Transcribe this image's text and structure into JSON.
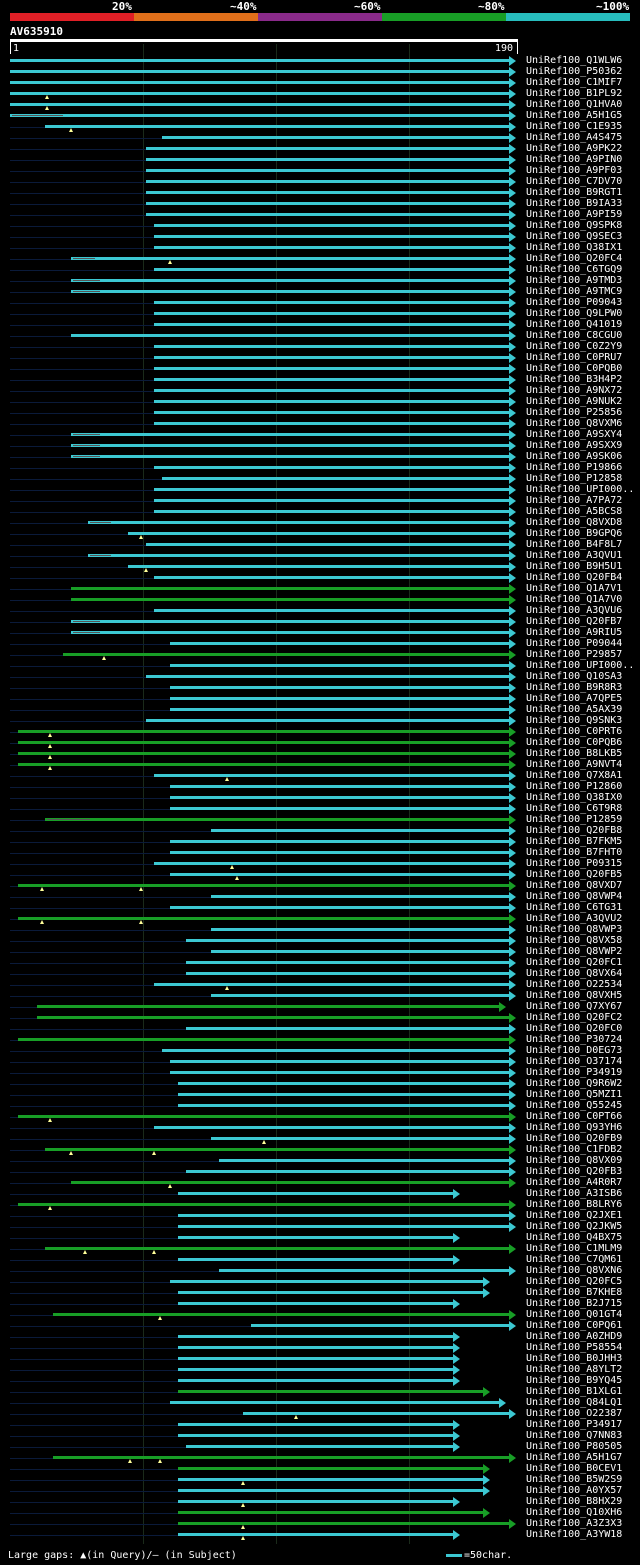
{
  "legend": {
    "labels": [
      "20%",
      "~40%",
      "~60%",
      "~80%",
      "~100%"
    ],
    "colors": [
      "#e01f26",
      "#e06f1a",
      "#8a2a8a",
      "#189e26",
      "#27bcbd"
    ]
  },
  "query": {
    "name": "AV635910",
    "start": "1",
    "end": "190"
  },
  "hits": [
    {
      "id": "UniRef100_Q1WLW6",
      "s": 1,
      "e": 190,
      "c": "#3cc8d2"
    },
    {
      "id": "UniRef100_P50362",
      "s": 1,
      "e": 190,
      "c": "#3cc8d2"
    },
    {
      "id": "UniRef100_C1MIF7",
      "s": 1,
      "e": 190,
      "c": "#3cc8d2"
    },
    {
      "id": "UniRef100_B1PL92",
      "s": 1,
      "e": 190,
      "c": "#3cc8d2",
      "m": [
        15
      ]
    },
    {
      "id": "UniRef100_Q1HVA0",
      "s": 1,
      "e": 190,
      "c": "#3cc8d2",
      "m": [
        15
      ]
    },
    {
      "id": "UniRef100_A5H1G5",
      "s": 1,
      "e": 190,
      "c": "#3cc8d2",
      "g": [
        20
      ]
    },
    {
      "id": "UniRef100_C1E935",
      "s": 14,
      "e": 190,
      "c": "#3cc8d2",
      "m": [
        24
      ]
    },
    {
      "id": "UniRef100_A4S475",
      "s": 58,
      "e": 190,
      "c": "#3cc8d2"
    },
    {
      "id": "UniRef100_A9PK22",
      "s": 52,
      "e": 190,
      "c": "#3cc8d2"
    },
    {
      "id": "UniRef100_A9PIN0",
      "s": 52,
      "e": 190,
      "c": "#3cc8d2"
    },
    {
      "id": "UniRef100_A9PF03",
      "s": 52,
      "e": 190,
      "c": "#3cc8d2"
    },
    {
      "id": "UniRef100_C7DV70",
      "s": 52,
      "e": 190,
      "c": "#3cc8d2"
    },
    {
      "id": "UniRef100_B9RGT1",
      "s": 52,
      "e": 190,
      "c": "#3cc8d2"
    },
    {
      "id": "UniRef100_B9IA33",
      "s": 52,
      "e": 190,
      "c": "#3cc8d2"
    },
    {
      "id": "UniRef100_A9PI59",
      "s": 52,
      "e": 190,
      "c": "#3cc8d2"
    },
    {
      "id": "UniRef100_Q9SPK8",
      "s": 55,
      "e": 190,
      "c": "#3cc8d2"
    },
    {
      "id": "UniRef100_Q9SEC3",
      "s": 55,
      "e": 190,
      "c": "#3cc8d2"
    },
    {
      "id": "UniRef100_Q38IX1",
      "s": 55,
      "e": 190,
      "c": "#3cc8d2"
    },
    {
      "id": "UniRef100_Q20FC4",
      "s": 24,
      "e": 190,
      "c": "#3cc8d2",
      "g": [
        32
      ],
      "m": [
        61
      ]
    },
    {
      "id": "UniRef100_C6TGQ9",
      "s": 55,
      "e": 190,
      "c": "#3cc8d2"
    },
    {
      "id": "UniRef100_A9TMD3",
      "s": 24,
      "e": 190,
      "c": "#3cc8d2",
      "g": [
        34
      ]
    },
    {
      "id": "UniRef100_A9TMC9",
      "s": 24,
      "e": 190,
      "c": "#3cc8d2",
      "g": [
        34
      ]
    },
    {
      "id": "UniRef100_P09043",
      "s": 55,
      "e": 190,
      "c": "#3cc8d2"
    },
    {
      "id": "UniRef100_Q9LPW0",
      "s": 55,
      "e": 190,
      "c": "#3cc8d2"
    },
    {
      "id": "UniRef100_Q41019",
      "s": 55,
      "e": 190,
      "c": "#3cc8d2"
    },
    {
      "id": "UniRef100_C8CGU0",
      "s": 24,
      "e": 190,
      "c": "#3cc8d2"
    },
    {
      "id": "UniRef100_C0Z2Y9",
      "s": 55,
      "e": 190,
      "c": "#3cc8d2"
    },
    {
      "id": "UniRef100_C0PRU7",
      "s": 55,
      "e": 190,
      "c": "#3cc8d2"
    },
    {
      "id": "UniRef100_C0PQB0",
      "s": 55,
      "e": 190,
      "c": "#3cc8d2"
    },
    {
      "id": "UniRef100_B3H4P2",
      "s": 55,
      "e": 190,
      "c": "#3cc8d2"
    },
    {
      "id": "UniRef100_A9NX72",
      "s": 55,
      "e": 190,
      "c": "#3cc8d2"
    },
    {
      "id": "UniRef100_A9NUK2",
      "s": 55,
      "e": 190,
      "c": "#3cc8d2"
    },
    {
      "id": "UniRef100_P25856",
      "s": 55,
      "e": 190,
      "c": "#3cc8d2"
    },
    {
      "id": "UniRef100_Q8VXM6",
      "s": 55,
      "e": 190,
      "c": "#3cc8d2"
    },
    {
      "id": "UniRef100_A9SXY4",
      "s": 24,
      "e": 190,
      "c": "#3cc8d2",
      "g": [
        34
      ]
    },
    {
      "id": "UniRef100_A9SXX9",
      "s": 24,
      "e": 190,
      "c": "#3cc8d2",
      "g": [
        34
      ]
    },
    {
      "id": "UniRef100_A9SK06",
      "s": 24,
      "e": 190,
      "c": "#3cc8d2",
      "g": [
        34
      ]
    },
    {
      "id": "UniRef100_P19866",
      "s": 55,
      "e": 190,
      "c": "#3cc8d2"
    },
    {
      "id": "UniRef100_P12858",
      "s": 58,
      "e": 190,
      "c": "#3cc8d2"
    },
    {
      "id": "UniRef100_UPI000..",
      "s": 55,
      "e": 190,
      "c": "#3cc8d2"
    },
    {
      "id": "UniRef100_A7PA72",
      "s": 55,
      "e": 190,
      "c": "#3cc8d2"
    },
    {
      "id": "UniRef100_A5BCS8",
      "s": 55,
      "e": 190,
      "c": "#3cc8d2"
    },
    {
      "id": "UniRef100_Q8VXD8",
      "s": 30,
      "e": 190,
      "c": "#3cc8d2",
      "g": [
        38
      ]
    },
    {
      "id": "UniRef100_B9GPQ6",
      "s": 45,
      "e": 190,
      "c": "#3cc8d2",
      "m": [
        50
      ]
    },
    {
      "id": "UniRef100_B4F8L7",
      "s": 52,
      "e": 190,
      "c": "#3cc8d2"
    },
    {
      "id": "UniRef100_A3QVU1",
      "s": 30,
      "e": 190,
      "c": "#3cc8d2",
      "g": [
        38
      ]
    },
    {
      "id": "UniRef100_B9H5U1",
      "s": 45,
      "e": 190,
      "c": "#3cc8d2",
      "m": [
        52
      ]
    },
    {
      "id": "UniRef100_Q20FB4",
      "s": 55,
      "e": 190,
      "c": "#3cc8d2"
    },
    {
      "id": "UniRef100_Q1A7V1",
      "s": 24,
      "e": 190,
      "c": "#189e26"
    },
    {
      "id": "UniRef100_Q1A7V0",
      "s": 24,
      "e": 190,
      "c": "#189e26"
    },
    {
      "id": "UniRef100_A3QVU6",
      "s": 55,
      "e": 190,
      "c": "#3cc8d2"
    },
    {
      "id": "UniRef100_Q20FB7",
      "s": 24,
      "e": 190,
      "c": "#3cc8d2",
      "g": [
        34
      ]
    },
    {
      "id": "UniRef100_A9RIU5",
      "s": 24,
      "e": 190,
      "c": "#3cc8d2",
      "g": [
        34
      ]
    },
    {
      "id": "UniRef100_P09044",
      "s": 61,
      "e": 190,
      "c": "#3cc8d2"
    },
    {
      "id": "UniRef100_P29857",
      "s": 21,
      "e": 190,
      "c": "#189e26",
      "m": [
        36
      ]
    },
    {
      "id": "UniRef100_UPI000..",
      "s": 61,
      "e": 190,
      "c": "#3cc8d2"
    },
    {
      "id": "UniRef100_Q10SA3",
      "s": 52,
      "e": 190,
      "c": "#3cc8d2"
    },
    {
      "id": "UniRef100_B9R8R3",
      "s": 61,
      "e": 190,
      "c": "#3cc8d2"
    },
    {
      "id": "UniRef100_A7QPE5",
      "s": 61,
      "e": 190,
      "c": "#3cc8d2"
    },
    {
      "id": "UniRef100_A5AX39",
      "s": 61,
      "e": 190,
      "c": "#3cc8d2"
    },
    {
      "id": "UniRef100_Q9SNK3",
      "s": 52,
      "e": 190,
      "c": "#3cc8d2"
    },
    {
      "id": "UniRef100_C0PRT6",
      "s": 4,
      "e": 190,
      "c": "#189e26",
      "m": [
        16
      ]
    },
    {
      "id": "UniRef100_C0PQB6",
      "s": 4,
      "e": 190,
      "c": "#189e26",
      "m": [
        16
      ]
    },
    {
      "id": "UniRef100_B8LKB5",
      "s": 4,
      "e": 190,
      "c": "#189e26",
      "m": [
        16
      ]
    },
    {
      "id": "UniRef100_A9NVT4",
      "s": 4,
      "e": 190,
      "c": "#189e26",
      "m": [
        16
      ]
    },
    {
      "id": "UniRef100_Q7X8A1",
      "s": 55,
      "e": 190,
      "c": "#3cc8d2",
      "m": [
        82
      ]
    },
    {
      "id": "UniRef100_P12860",
      "s": 61,
      "e": 190,
      "c": "#3cc8d2"
    },
    {
      "id": "UniRef100_Q38IX0",
      "s": 61,
      "e": 190,
      "c": "#3cc8d2"
    },
    {
      "id": "UniRef100_C6T9R8",
      "s": 61,
      "e": 190,
      "c": "#3cc8d2"
    },
    {
      "id": "UniRef100_P12859",
      "s": 14,
      "e": 190,
      "c": "#189e26",
      "g": [
        30
      ]
    },
    {
      "id": "UniRef100_Q20FB8",
      "s": 76,
      "e": 190,
      "c": "#3cc8d2"
    },
    {
      "id": "UniRef100_B7FKM5",
      "s": 61,
      "e": 190,
      "c": "#3cc8d2"
    },
    {
      "id": "UniRef100_B7FHT0",
      "s": 61,
      "e": 190,
      "c": "#3cc8d2"
    },
    {
      "id": "UniRef100_P09315",
      "s": 55,
      "e": 190,
      "c": "#3cc8d2",
      "m": [
        84
      ]
    },
    {
      "id": "UniRef100_Q20FB5",
      "s": 61,
      "e": 190,
      "c": "#3cc8d2",
      "m": [
        86
      ]
    },
    {
      "id": "UniRef100_Q8VXD7",
      "s": 4,
      "e": 190,
      "c": "#189e26",
      "m": [
        13,
        50
      ]
    },
    {
      "id": "UniRef100_Q8VWP4",
      "s": 76,
      "e": 190,
      "c": "#3cc8d2"
    },
    {
      "id": "UniRef100_C6TG31",
      "s": 61,
      "e": 190,
      "c": "#3cc8d2"
    },
    {
      "id": "UniRef100_A3QVU2",
      "s": 4,
      "e": 190,
      "c": "#189e26",
      "m": [
        13,
        50
      ]
    },
    {
      "id": "UniRef100_Q8VWP3",
      "s": 76,
      "e": 190,
      "c": "#3cc8d2"
    },
    {
      "id": "UniRef100_Q8VX58",
      "s": 67,
      "e": 190,
      "c": "#3cc8d2"
    },
    {
      "id": "UniRef100_Q8VWP2",
      "s": 76,
      "e": 190,
      "c": "#3cc8d2"
    },
    {
      "id": "UniRef100_Q20FC1",
      "s": 67,
      "e": 190,
      "c": "#3cc8d2"
    },
    {
      "id": "UniRef100_Q8VX64",
      "s": 67,
      "e": 190,
      "c": "#3cc8d2"
    },
    {
      "id": "UniRef100_O22534",
      "s": 55,
      "e": 190,
      "c": "#3cc8d2",
      "m": [
        82
      ]
    },
    {
      "id": "UniRef100_Q8VXH5",
      "s": 76,
      "e": 190,
      "c": "#3cc8d2"
    },
    {
      "id": "UniRef100_Q7XY67",
      "s": 11,
      "e": 186,
      "c": "#189e26"
    },
    {
      "id": "UniRef100_Q20FC2",
      "s": 11,
      "e": 190,
      "c": "#189e26"
    },
    {
      "id": "UniRef100_Q20FC0",
      "s": 67,
      "e": 190,
      "c": "#3cc8d2"
    },
    {
      "id": "UniRef100_P30724",
      "s": 4,
      "e": 190,
      "c": "#189e26"
    },
    {
      "id": "UniRef100_D0EG73",
      "s": 58,
      "e": 190,
      "c": "#3cc8d2"
    },
    {
      "id": "UniRef100_O37174",
      "s": 61,
      "e": 190,
      "c": "#3cc8d2"
    },
    {
      "id": "UniRef100_P34919",
      "s": 61,
      "e": 190,
      "c": "#3cc8d2"
    },
    {
      "id": "UniRef100_Q9R6W2",
      "s": 64,
      "e": 190,
      "c": "#3cc8d2"
    },
    {
      "id": "UniRef100_Q5MZI1",
      "s": 64,
      "e": 190,
      "c": "#3cc8d2"
    },
    {
      "id": "UniRef100_Q55245",
      "s": 64,
      "e": 190,
      "c": "#3cc8d2"
    },
    {
      "id": "UniRef100_C0PT66",
      "s": 4,
      "e": 190,
      "c": "#189e26",
      "m": [
        16
      ]
    },
    {
      "id": "UniRef100_Q93YH6",
      "s": 55,
      "e": 190,
      "c": "#3cc8d2"
    },
    {
      "id": "UniRef100_Q20FB9",
      "s": 76,
      "e": 190,
      "c": "#3cc8d2",
      "m": [
        96
      ]
    },
    {
      "id": "UniRef100_C1FDB2",
      "s": 14,
      "e": 190,
      "c": "#189e26",
      "m": [
        24,
        55
      ]
    },
    {
      "id": "UniRef100_Q8VX09",
      "s": 79,
      "e": 190,
      "c": "#3cc8d2"
    },
    {
      "id": "UniRef100_Q20FB3",
      "s": 67,
      "e": 190,
      "c": "#3cc8d2"
    },
    {
      "id": "UniRef100_A4R0R7",
      "s": 24,
      "e": 190,
      "c": "#189e26",
      "m": [
        61
      ]
    },
    {
      "id": "UniRef100_A3ISB6",
      "s": 64,
      "e": 169,
      "c": "#3cc8d2"
    },
    {
      "id": "UniRef100_B8LRY6",
      "s": 4,
      "e": 190,
      "c": "#189e26",
      "m": [
        16
      ]
    },
    {
      "id": "UniRef100_Q2JXE1",
      "s": 64,
      "e": 190,
      "c": "#3cc8d2"
    },
    {
      "id": "UniRef100_Q2JKW5",
      "s": 64,
      "e": 190,
      "c": "#3cc8d2"
    },
    {
      "id": "UniRef100_Q4BX75",
      "s": 64,
      "e": 169,
      "c": "#3cc8d2"
    },
    {
      "id": "UniRef100_C1MLM9",
      "s": 14,
      "e": 190,
      "c": "#189e26",
      "m": [
        29,
        55
      ]
    },
    {
      "id": "UniRef100_C7QM61",
      "s": 64,
      "e": 169,
      "c": "#3cc8d2"
    },
    {
      "id": "UniRef100_Q8VXN6",
      "s": 79,
      "e": 190,
      "c": "#3cc8d2"
    },
    {
      "id": "UniRef100_Q20FC5",
      "s": 61,
      "e": 180,
      "c": "#3cc8d2"
    },
    {
      "id": "UniRef100_B7KHE8",
      "s": 64,
      "e": 180,
      "c": "#3cc8d2"
    },
    {
      "id": "UniRef100_B2J715",
      "s": 64,
      "e": 169,
      "c": "#3cc8d2"
    },
    {
      "id": "UniRef100_Q01GT4",
      "s": 17,
      "e": 190,
      "c": "#189e26",
      "m": [
        57
      ]
    },
    {
      "id": "UniRef100_C0PQ61",
      "s": 91,
      "e": 190,
      "c": "#3cc8d2"
    },
    {
      "id": "UniRef100_A0ZHD9",
      "s": 64,
      "e": 169,
      "c": "#3cc8d2"
    },
    {
      "id": "UniRef100_P58554",
      "s": 64,
      "e": 169,
      "c": "#3cc8d2"
    },
    {
      "id": "UniRef100_B0JHH3",
      "s": 64,
      "e": 169,
      "c": "#3cc8d2"
    },
    {
      "id": "UniRef100_A8YLT2",
      "s": 64,
      "e": 169,
      "c": "#3cc8d2"
    },
    {
      "id": "UniRef100_B9YQ45",
      "s": 64,
      "e": 169,
      "c": "#3cc8d2"
    },
    {
      "id": "UniRef100_B1XLG1",
      "s": 64,
      "e": 180,
      "c": "#189e26"
    },
    {
      "id": "UniRef100_Q84LQ1",
      "s": 61,
      "e": 186,
      "c": "#3cc8d2"
    },
    {
      "id": "UniRef100_O22387",
      "s": 88,
      "e": 190,
      "c": "#3cc8d2",
      "m": [
        108
      ]
    },
    {
      "id": "UniRef100_P34917",
      "s": 64,
      "e": 169,
      "c": "#3cc8d2"
    },
    {
      "id": "UniRef100_Q7NN83",
      "s": 64,
      "e": 169,
      "c": "#3cc8d2"
    },
    {
      "id": "UniRef100_P80505",
      "s": 67,
      "e": 169,
      "c": "#3cc8d2"
    },
    {
      "id": "UniRef100_A5H1G7",
      "s": 17,
      "e": 190,
      "c": "#189e26",
      "m": [
        46,
        57
      ]
    },
    {
      "id": "UniRef100_B0CEV1",
      "s": 64,
      "e": 180,
      "c": "#189e26"
    },
    {
      "id": "UniRef100_B5W2S9",
      "s": 64,
      "e": 180,
      "c": "#3cc8d2",
      "m": [
        88
      ]
    },
    {
      "id": "UniRef100_A0YX57",
      "s": 64,
      "e": 180,
      "c": "#3cc8d2"
    },
    {
      "id": "UniRef100_B8HX29",
      "s": 64,
      "e": 169,
      "c": "#3cc8d2",
      "m": [
        88
      ]
    },
    {
      "id": "UniRef100_Q10XH6",
      "s": 64,
      "e": 180,
      "c": "#189e26"
    },
    {
      "id": "UniRef100_A3Z3X3",
      "s": 64,
      "e": 190,
      "c": "#189e26",
      "m": [
        88
      ]
    },
    {
      "id": "UniRef100_A3YW18",
      "s": 64,
      "e": 169,
      "c": "#3cc8d2",
      "m": [
        88
      ]
    }
  ],
  "footer": {
    "gaps_label": "Large gaps: ▲(in Query)/– (in Subject)",
    "scale_label": "=50char."
  }
}
